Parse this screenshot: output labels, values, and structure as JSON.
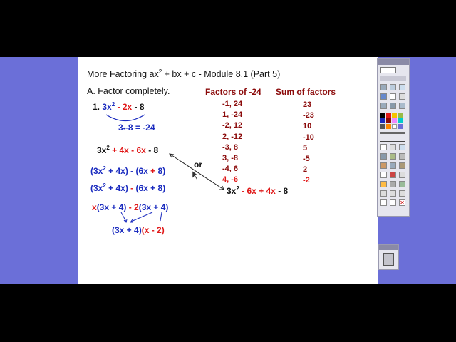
{
  "board": {
    "title_prefix": "More Factoring ax",
    "title_exp": "2",
    "title_suffix": " + bx + c - Module 8.1 (Part 5)",
    "section": "A. Factor completely.",
    "problem": {
      "number": "1. ",
      "p1": "3x",
      "p1_exp": "2",
      "p2": " - 2x",
      "p3": " - 8"
    },
    "product": {
      "p1": "3",
      "p2": "•",
      "p3": "-8 = -24"
    },
    "step1": {
      "p1": "3x",
      "p1_exp": "2",
      "p2": " + 4x",
      "p3": " - 6x",
      "p4": " - 8"
    },
    "step2": {
      "p1": "(3x",
      "p1_exp": "2",
      "p2": " + 4x) - (6x ",
      "p3": "+",
      "p4": " 8)"
    },
    "step3": {
      "p1": "(3x",
      "p1_exp": "2",
      "p2": " + 4x)",
      "p3": " - ",
      "p4": "(6x + 8)"
    },
    "step4": {
      "p1": "x",
      "p2": "(3x + 4)",
      "p3": " - 2",
      "p4": "(3x + 4)"
    },
    "step5": {
      "p1": "(3x + 4)",
      "p2": "(x - 2)"
    },
    "or_label": "or",
    "alt": {
      "p1": "3x",
      "p1_exp": "2",
      "p2": " - 6x",
      "p3": " + 4x",
      "p4": " - 8"
    },
    "factors_header": "Factors of -24",
    "sums_header": "Sum of factors",
    "factors": [
      "-1, 24",
      "1, -24",
      "-2, 12",
      "2, -12",
      "-3, 8",
      "3, -8",
      "-4, 6",
      "4, -6"
    ],
    "sums": [
      "23",
      "-23",
      "10",
      "-10",
      "5",
      "-5",
      "2",
      "-2"
    ]
  },
  "colors": {
    "blue": "#1a2bbf",
    "red": "#e01818",
    "maroon": "#8b0a0a",
    "background": "#6b6fd8"
  },
  "icons": {
    "toolbar": [
      "toolbar-tools-icon",
      "pen-icon",
      "highlighter-icon",
      "eraser-icon",
      "shape-icon",
      "text-icon",
      "color-palette-icon",
      "undo-icon",
      "redo-icon",
      "delete-icon"
    ],
    "trash": "trash-icon"
  }
}
